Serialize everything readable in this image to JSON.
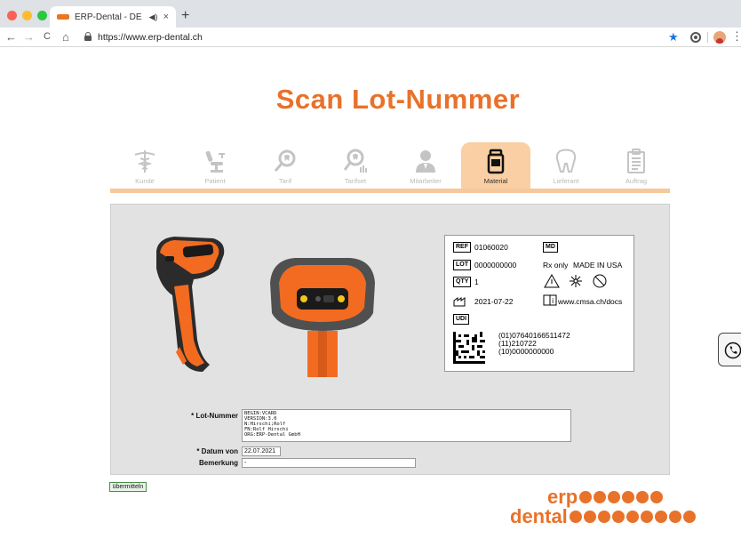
{
  "browser": {
    "tab_title": "ERP-Dental - DE",
    "tab_audio_icon": "speaker-icon",
    "close_glyph": "×",
    "new_tab_glyph": "+",
    "url": "https://www.erp-dental.ch",
    "back_glyph": "←",
    "forward_glyph": "→",
    "reload_glyph": "C",
    "home_glyph": "⌂",
    "star_glyph": "★",
    "menu_glyph": "⋮"
  },
  "page": {
    "title": "Scan Lot-Nummer"
  },
  "steps": [
    {
      "label": "Kunde",
      "icon": "caduceus-icon"
    },
    {
      "label": "Patient",
      "icon": "dental-chair-icon"
    },
    {
      "label": "Tarif",
      "icon": "magnifier-tooth-icon"
    },
    {
      "label": "Tarifset",
      "icon": "magnifier-set-icon"
    },
    {
      "label": "Mitarbeiter",
      "icon": "employee-icon"
    },
    {
      "label": "Material",
      "icon": "jar-icon"
    },
    {
      "label": "Lieferant",
      "icon": "tooth-icon"
    },
    {
      "label": "Auftrag",
      "icon": "clipboard-icon"
    }
  ],
  "active_step": "Material",
  "label": {
    "ref_tag": "REF",
    "ref_value": "01060020",
    "md_tag": "MD",
    "lot_tag": "LOT",
    "lot_value": "0000000000",
    "rx_text": "Rx only",
    "made_in": "MADE IN USA",
    "qty_tag": "QTY",
    "qty_value": "1",
    "date_value": "2021-07-22",
    "docs_url": "www.cmsa.ch/docs",
    "udi_tag": "UDI",
    "udi_lines": [
      "(01)07640166511472",
      "(11)210722",
      "(10)0000000000"
    ]
  },
  "form": {
    "lot_label": "* Lot-Nummer",
    "lot_value": "BEGIN:VCARD\nVERSION:3.0\nN:Hirschi;Rolf\nFN:Rolf Hirschi\nORG:ERP-Dental GmbH",
    "date_label": "* Datum von",
    "date_value": "22.07.2021",
    "remark_label": "Bemerkung",
    "remark_value": "-",
    "submit_label": "übermitteln"
  },
  "logo": {
    "line1": "erp",
    "line2": "dental",
    "dots1": 6,
    "dots2": 9
  },
  "colors": {
    "accent": "#e8722a",
    "step_active_bg": "#f9cfa3",
    "panel_bg": "#e2e2e2"
  }
}
